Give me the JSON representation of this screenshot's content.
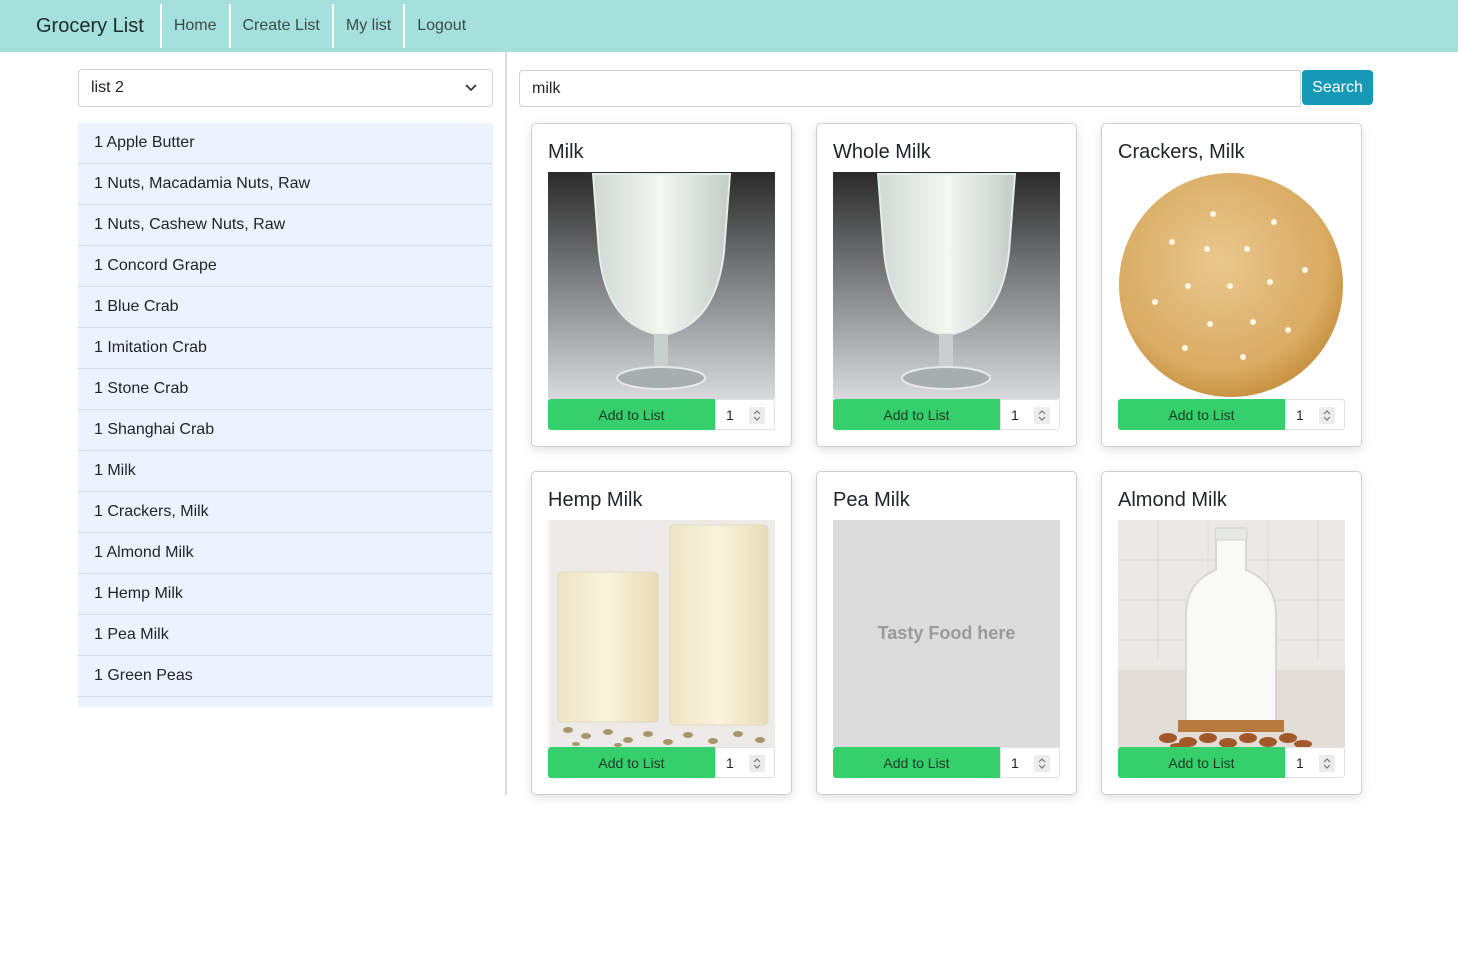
{
  "navbar": {
    "brand": "Grocery List",
    "items": [
      "Home",
      "Create List",
      "My list",
      "Logout"
    ]
  },
  "list_selector": {
    "selected": "list 2"
  },
  "grocery_list": [
    "1 Apple Butter",
    "1 Nuts, Macadamia Nuts, Raw",
    "1 Nuts, Cashew Nuts, Raw",
    "1 Concord Grape",
    "1 Blue Crab",
    "1 Imitation Crab",
    "1 Stone Crab",
    "1 Shanghai Crab",
    "1 Milk",
    "1 Crackers, Milk",
    "1 Almond Milk",
    "1 Hemp Milk",
    "1 Pea Milk",
    "1 Green Peas"
  ],
  "search": {
    "value": "milk",
    "button_label": "Search"
  },
  "results": [
    {
      "title": "Milk",
      "image": "glass-of-milk",
      "add_label": "Add to List",
      "qty": "1"
    },
    {
      "title": "Whole Milk",
      "image": "glass-of-milk",
      "add_label": "Add to List",
      "qty": "1"
    },
    {
      "title": "Crackers, Milk",
      "image": "round-cracker",
      "add_label": "Add to List",
      "qty": "1"
    },
    {
      "title": "Hemp Milk",
      "image": "hemp-milk-glasses",
      "add_label": "Add to List",
      "qty": "1"
    },
    {
      "title": "Pea Milk",
      "image": "placeholder",
      "placeholder_text": "Tasty Food here",
      "add_label": "Add to List",
      "qty": "1"
    },
    {
      "title": "Almond Milk",
      "image": "milk-bottle-almonds",
      "add_label": "Add to List",
      "qty": "1"
    }
  ],
  "colors": {
    "navbar": "#a4e1dc",
    "search_button": "#1599b6",
    "add_button": "#35d06c",
    "list_background": "#ebf3ff"
  }
}
